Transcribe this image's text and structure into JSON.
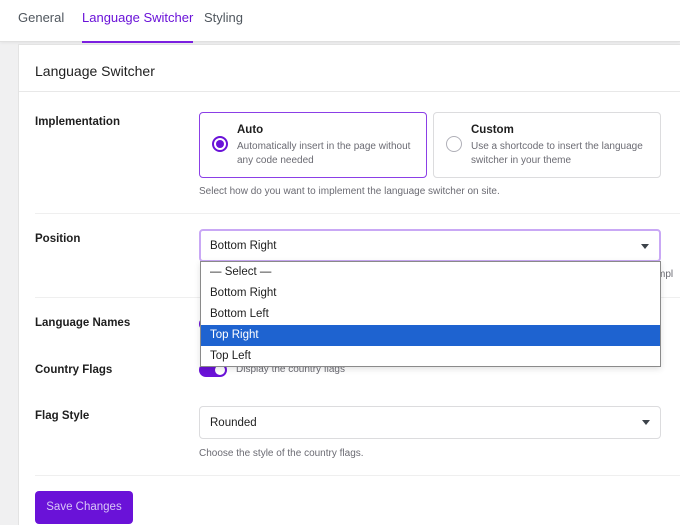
{
  "tabs": [
    {
      "label": "General"
    },
    {
      "label": "Language Switcher"
    },
    {
      "label": "Styling"
    }
  ],
  "panel": {
    "title": "Language Switcher"
  },
  "implementation": {
    "label": "Implementation",
    "options": [
      {
        "title": "Auto",
        "desc": "Automatically insert in the page without any code needed",
        "selected": true
      },
      {
        "title": "Custom",
        "desc": "Use a shortcode to insert the language switcher in your theme",
        "selected": false
      }
    ],
    "help": "Select how do you want to implement the language switcher on site."
  },
  "position": {
    "label": "Position",
    "value": "Bottom Right",
    "help_fragment": "mpl",
    "options": [
      "— Select —",
      "Bottom Right",
      "Bottom Left",
      "Top Right",
      "Top Left"
    ],
    "highlighted": "Top Right"
  },
  "language_names": {
    "label": "Language Names",
    "enabled": true
  },
  "country_flags": {
    "label": "Country Flags",
    "enabled": true,
    "desc": "Display the country flags"
  },
  "flag_style": {
    "label": "Flag Style",
    "value": "Rounded",
    "help": "Choose the style of the country flags."
  },
  "save_button": {
    "label": "Save Changes"
  },
  "colors": {
    "accent": "#6a12d8",
    "highlight": "#1e63d0"
  }
}
